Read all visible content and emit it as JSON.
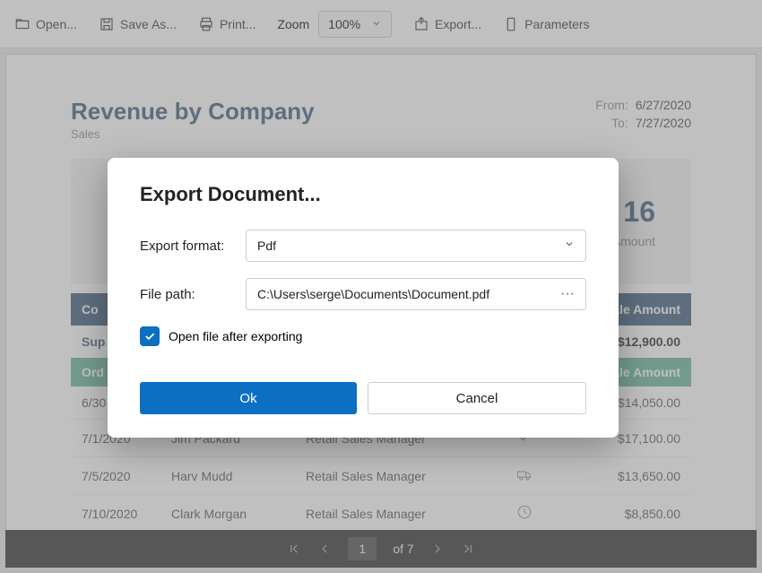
{
  "toolbar": {
    "open": "Open...",
    "save_as": "Save As...",
    "print": "Print...",
    "zoom_label": "Zoom",
    "zoom_value": "100%",
    "export": "Export...",
    "parameters": "Parameters"
  },
  "document": {
    "title": "Revenue by Company",
    "subtitle": "Sales",
    "from_label": "From:",
    "from_value": "6/27/2020",
    "to_label": "To:",
    "to_value": "7/27/2020",
    "summary_number": "16",
    "summary_caption": "e Amount"
  },
  "table": {
    "main_headers": {
      "company": "Co",
      "sale_amount": "ale Amount"
    },
    "company_row": {
      "name": "Sup",
      "amount": "$12,900.00"
    },
    "sub_headers": {
      "order_date": "Ord",
      "rep": "",
      "role": "",
      "status": "",
      "sale_amount": "Sale Amount"
    },
    "rows": [
      {
        "date": "6/30",
        "rep": "",
        "role": "",
        "status": "",
        "amount": "$14,050.00"
      },
      {
        "date": "7/1/2020",
        "rep": "Jim Packard",
        "role": "Retail Sales Manager",
        "status": "check",
        "amount": "$17,100.00"
      },
      {
        "date": "7/5/2020",
        "rep": "Harv Mudd",
        "role": "Retail Sales Manager",
        "status": "truck",
        "amount": "$13,650.00"
      },
      {
        "date": "7/10/2020",
        "rep": "Clark Morgan",
        "role": "Retail Sales Manager",
        "status": "clock",
        "amount": "$8,850.00"
      }
    ]
  },
  "pager": {
    "current": "1",
    "total_label": "of 7"
  },
  "dialog": {
    "title": "Export Document...",
    "format_label": "Export format:",
    "format_value": "Pdf",
    "path_label": "File path:",
    "path_value": "C:\\Users\\serge\\Documents\\Document.pdf",
    "open_after_label": "Open file after exporting",
    "ok": "Ok",
    "cancel": "Cancel"
  }
}
